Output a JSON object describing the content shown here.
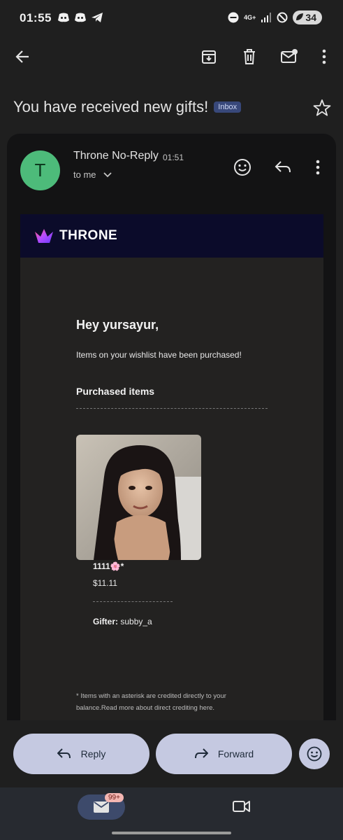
{
  "status_bar": {
    "time": "01:55",
    "network": "4G+",
    "battery": "34"
  },
  "subject": {
    "title": "You have received new gifts!",
    "label": "Inbox"
  },
  "message": {
    "avatar_letter": "T",
    "sender": "Throne No-Reply",
    "time": "01:51",
    "recipient": "to me"
  },
  "email": {
    "brand": "THRONE",
    "greeting": "Hey yursayur,",
    "intro": "Items on your wishlist have been purchased!",
    "section_title": "Purchased items",
    "item": {
      "name": "1111🌸*",
      "price": "$11.11",
      "gifter_label": "Gifter:",
      "gifter": "subby_a"
    },
    "footnote": "* Items with an asterisk are credited directly to your balance.Read more about direct crediting here."
  },
  "actions": {
    "reply": "Reply",
    "forward": "Forward"
  },
  "nav": {
    "mail_badge": "99+"
  },
  "colors": {
    "background": "#1f1f1f",
    "card": "#131314",
    "accent_button": "#c5c9e1",
    "avatar": "#4dbb7a",
    "brand_bar": "#0b0b2a"
  }
}
